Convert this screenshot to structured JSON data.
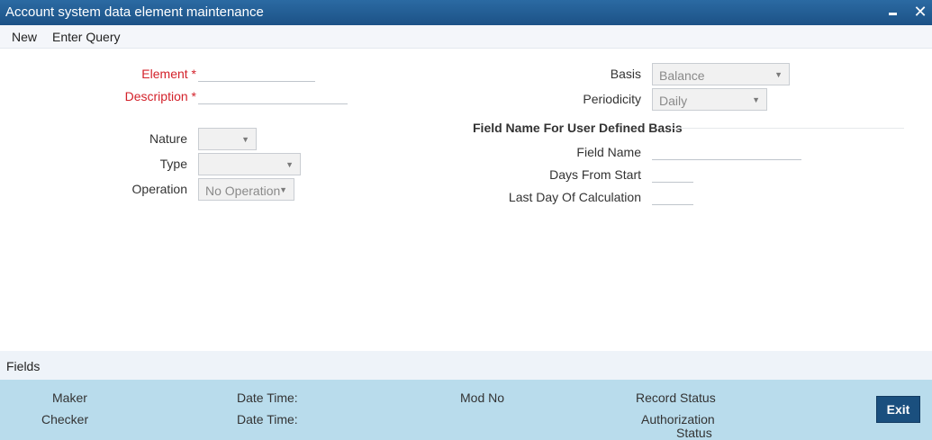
{
  "window": {
    "title": "Account system data element maintenance",
    "close_glyph": "✕"
  },
  "menu": {
    "new": "New",
    "enter_query": "Enter Query"
  },
  "form": {
    "element_label": "Element *",
    "element_value": "",
    "description_label": "Description *",
    "description_value": "",
    "nature_label": "Nature",
    "nature_value": "",
    "type_label": "Type",
    "type_value": "",
    "operation_label": "Operation",
    "operation_value": "No Operation",
    "basis_label": "Basis",
    "basis_value": "Balance",
    "periodicity_label": "Periodicity",
    "periodicity_value": "Daily",
    "section_title": "Field Name For User Defined Basis",
    "field_name_label": "Field Name",
    "field_name_value": "",
    "days_from_start_label": "Days From Start",
    "days_from_start_value": "",
    "last_day_label": "Last Day Of Calculation",
    "last_day_value": "",
    "dropdown_arrow": "▼"
  },
  "fields_bar": {
    "label": "Fields"
  },
  "footer": {
    "maker_label": "Maker",
    "checker_label": "Checker",
    "maker_datetime_label": "Date Time:",
    "checker_datetime_label": "Date Time:",
    "mod_no_label": "Mod No",
    "record_status_label": "Record Status",
    "authorization_label": "Authorization",
    "status_label": "Status",
    "exit_label": "Exit"
  },
  "colors": {
    "titlebar": "#1d5a8e",
    "required_label": "#d3212a",
    "footer_bg": "#b9dcec",
    "exit_button": "#1a4f7e"
  },
  "icons": {
    "minimize": "minimize-icon",
    "close": "close-icon",
    "dropdown": "chevron-down-icon"
  }
}
